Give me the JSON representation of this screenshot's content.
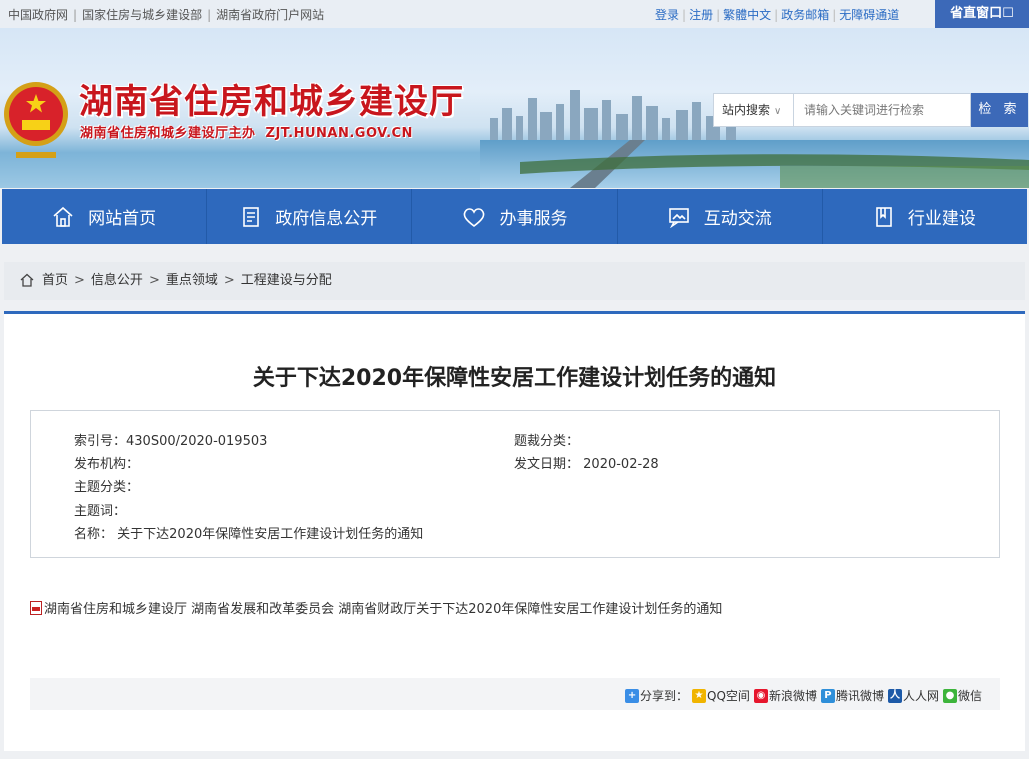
{
  "topbar": {
    "left_links": [
      "中国政府网",
      "国家住房与城乡建设部",
      "湖南省政府门户网站"
    ],
    "right_links": [
      "登录",
      "注册",
      "繁體中文",
      "政务邮箱",
      "无障碍通道"
    ],
    "org_button": "省直窗口"
  },
  "header": {
    "title": "湖南省住房和城乡建设厅",
    "subtitle": "湖南省住房和城乡建设厅主办",
    "domain": "ZJT.HUNAN.GOV.CN"
  },
  "search": {
    "scope": "站内搜索",
    "placeholder": "请输入关键词进行检索",
    "button": "检 索"
  },
  "nav": [
    {
      "label": "网站首页",
      "icon": "home-icon"
    },
    {
      "label": "政府信息公开",
      "icon": "document-icon"
    },
    {
      "label": "办事服务",
      "icon": "heart-icon"
    },
    {
      "label": "互动交流",
      "icon": "chat-image-icon"
    },
    {
      "label": "行业建设",
      "icon": "book-icon"
    }
  ],
  "breadcrumb": [
    "首页",
    "信息公开",
    "重点领域",
    "工程建设与分配"
  ],
  "article": {
    "title": "关于下达2020年保障性安居工作建设计划任务的通知",
    "meta": {
      "index_no": "索引号：430S00/2020-019503",
      "genre": "题裁分类：",
      "publisher": "发布机构：",
      "issue_date_label": "发文日期：",
      "issue_date": "2020-02-28",
      "topic": "主题分类：",
      "keywords": "主题词：",
      "name_label": "名称：",
      "name": "关于下达2020年保障性安居工作建设计划任务的通知"
    },
    "attachment": "湖南省住房和城乡建设厅 湖南省发展和改革委员会 湖南省财政厅关于下达2020年保障性安居工作建设计划任务的通知"
  },
  "share": {
    "label": "分享到：",
    "targets": [
      {
        "label": "QQ空间",
        "color": "#f0b400"
      },
      {
        "label": "新浪微博",
        "color": "#e6162d"
      },
      {
        "label": "腾讯微博",
        "color": "#2f8fd9"
      },
      {
        "label": "人人网",
        "color": "#1d5aa8"
      },
      {
        "label": "微信",
        "color": "#3db43b"
      }
    ]
  },
  "colors": {
    "brand_blue": "#2e69bd",
    "title_red": "#c8161d"
  }
}
